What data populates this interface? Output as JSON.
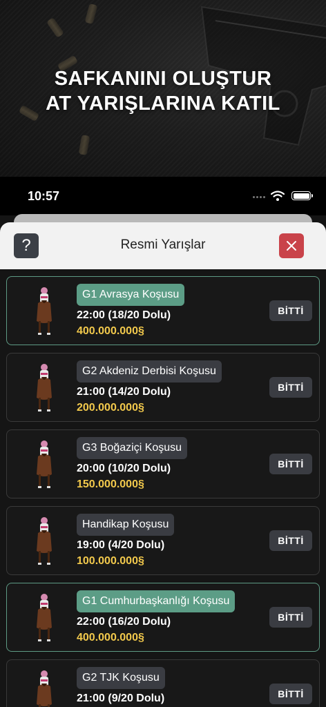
{
  "promo": {
    "title_line1": "SAFKANINI OLUŞTUR",
    "title_line2": "AT YARIŞLARINA KATIL"
  },
  "status_bar": {
    "time": "10:57",
    "icons": [
      "signal-icon",
      "wifi-icon",
      "battery-icon"
    ]
  },
  "modal": {
    "title": "Resmi Yarışlar",
    "help_label": "?",
    "close_icon": "close-icon",
    "colors": {
      "close": "#c9434a",
      "active": "#5c9d86",
      "prize": "#f2c94c"
    }
  },
  "races": [
    {
      "name": "G1 Avrasya Koşusu",
      "time": "22:00 (18/20 Dolu)",
      "prize": "400.000.000§",
      "status": "BİTTİ",
      "highlight": true
    },
    {
      "name": "G2 Akdeniz Derbisi Koşusu",
      "time": "21:00 (14/20 Dolu)",
      "prize": "200.000.000§",
      "status": "BİTTİ",
      "highlight": false
    },
    {
      "name": "G3 Boğaziçi Koşusu",
      "time": "20:00 (10/20 Dolu)",
      "prize": "150.000.000§",
      "status": "BİTTİ",
      "highlight": false
    },
    {
      "name": "Handikap Koşusu",
      "time": "19:00 (4/20 Dolu)",
      "prize": "100.000.000§",
      "status": "BİTTİ",
      "highlight": false
    },
    {
      "name": "G1 Cumhurbaşkanlığı Koşusu",
      "time": "22:00 (16/20 Dolu)",
      "prize": "400.000.000§",
      "status": "BİTTİ",
      "highlight": true
    },
    {
      "name": "G2 TJK Koşusu",
      "time": "21:00 (9/20 Dolu)",
      "prize": "",
      "status": "BİTTİ",
      "highlight": false
    }
  ]
}
